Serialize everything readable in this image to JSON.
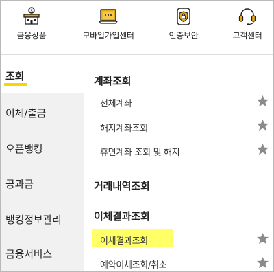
{
  "topnav": {
    "items": [
      {
        "label": "금융상품",
        "icon": "bank-icon"
      },
      {
        "label": "모바일가입센터",
        "icon": "laptop-icon"
      },
      {
        "label": "인증보안",
        "icon": "shield-icon"
      },
      {
        "label": "고객센터",
        "icon": "headset-icon"
      }
    ]
  },
  "sidebar": {
    "items": [
      {
        "label": "조회",
        "active": true
      },
      {
        "label": "이체/출금"
      },
      {
        "label": "오픈뱅킹"
      },
      {
        "label": "공과금"
      },
      {
        "label": "뱅킹정보관리"
      },
      {
        "label": "금융서비스"
      }
    ]
  },
  "content": {
    "sections": [
      {
        "title": "계좌조회",
        "items": [
          "전체계좌",
          "해지계좌조회",
          "휴면계좌 조회 및 해지"
        ]
      },
      {
        "title": "거래내역조회",
        "items": []
      },
      {
        "title": "이체결과조회",
        "items": [
          "이체결과조회",
          "예약이체조회/취소"
        ]
      }
    ],
    "highlighted_item": "이체결과조회"
  },
  "colors": {
    "accent_yellow": "#f6d700",
    "highlight": "#ffff66",
    "icon_gold": "#e2a81a",
    "star_gray": "#8a8a8a",
    "sidebar_bg": "#f1f1f1"
  }
}
